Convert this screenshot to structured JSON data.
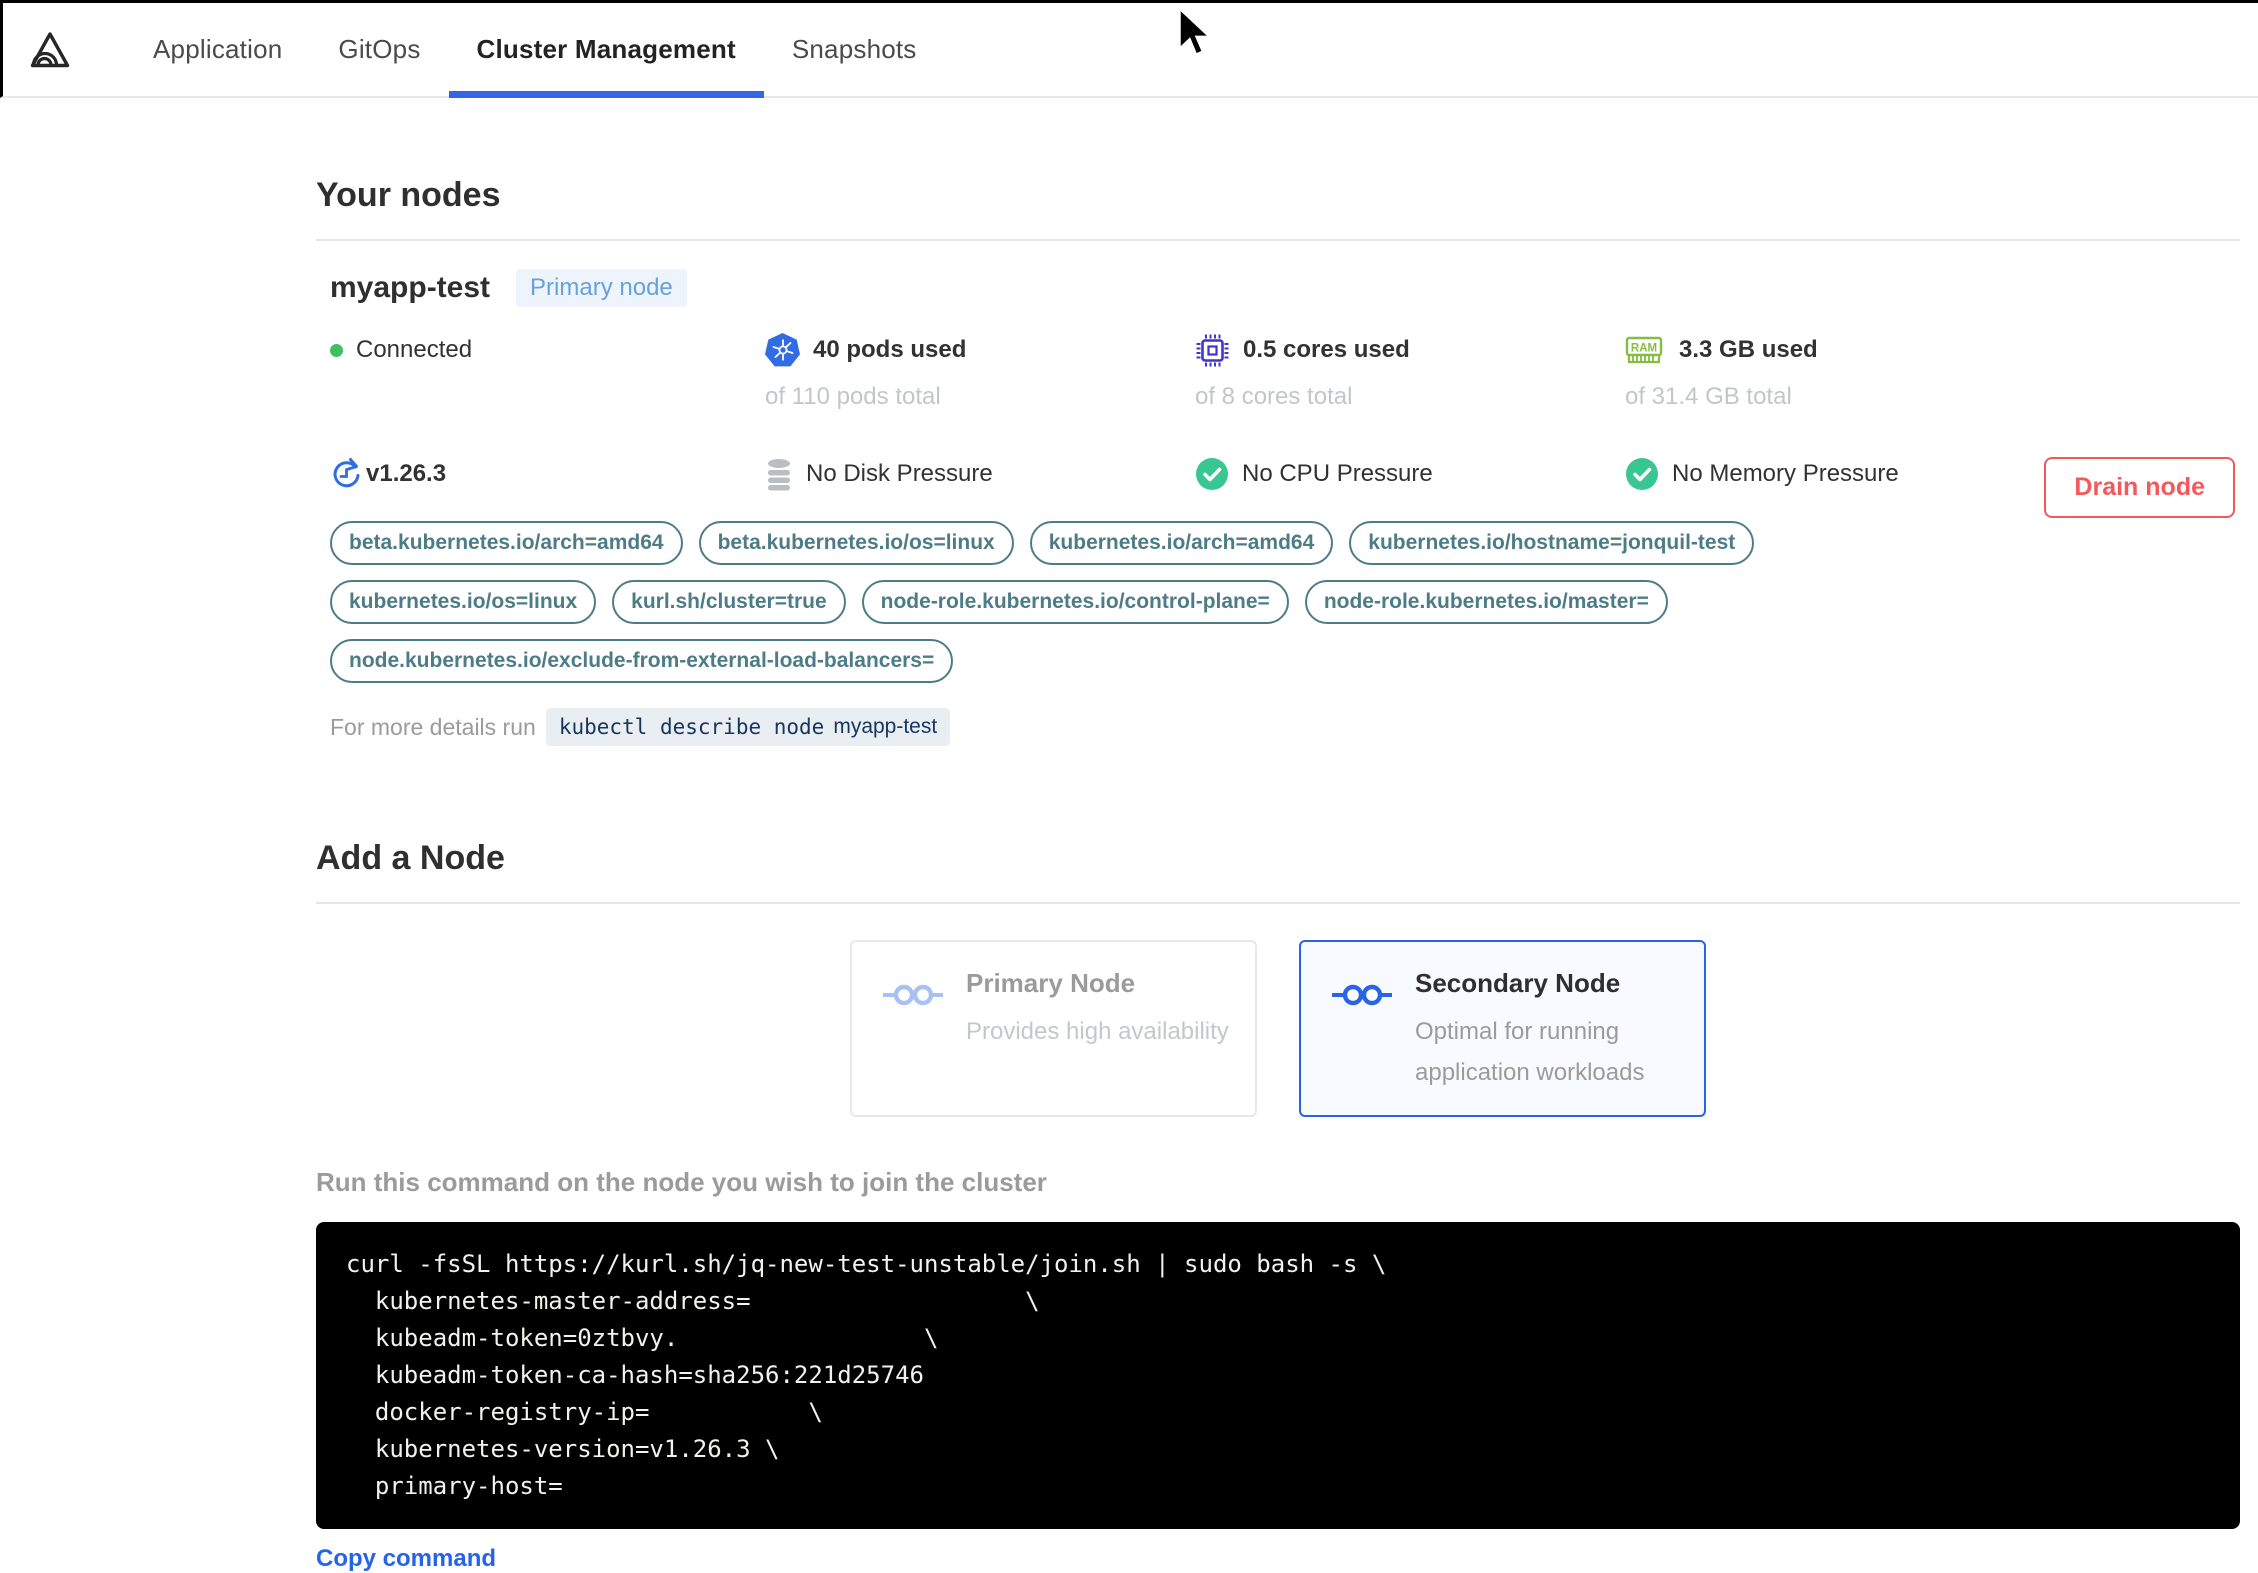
{
  "nav": {
    "logo": "app-logo-triangle-waves",
    "tabs": [
      {
        "label": "Application",
        "active": false
      },
      {
        "label": "GitOps",
        "active": false
      },
      {
        "label": "Cluster Management",
        "active": true
      },
      {
        "label": "Snapshots",
        "active": false
      }
    ]
  },
  "your_nodes": {
    "title": "Your nodes",
    "node": {
      "name": "myapp-test",
      "badge": "Primary node",
      "status": "Connected",
      "version": "v1.26.3",
      "stats": [
        {
          "icon": "kubernetes-icon",
          "used": "40 pods used",
          "total": "of 110 pods total"
        },
        {
          "icon": "cpu-icon",
          "used": "0.5 cores used",
          "total": "of 8 cores total"
        },
        {
          "icon": "ram-icon",
          "used": "3.3 GB used",
          "total": "of 31.4 GB total"
        }
      ],
      "conditions": [
        {
          "icon": "disk-icon",
          "label": "No Disk Pressure"
        },
        {
          "icon": "check-circle-icon",
          "label": "No CPU Pressure"
        },
        {
          "icon": "check-circle-icon",
          "label": "No Memory Pressure"
        }
      ],
      "labels": [
        "beta.kubernetes.io/arch=amd64",
        "beta.kubernetes.io/os=linux",
        "kubernetes.io/arch=amd64",
        "kubernetes.io/hostname=jonquil-test",
        "kubernetes.io/os=linux",
        "kurl.sh/cluster=true",
        "node-role.kubernetes.io/control-plane=",
        "node-role.kubernetes.io/master=",
        "node.kubernetes.io/exclude-from-external-load-balancers="
      ],
      "details": {
        "prefix": "For more details run",
        "command": "kubectl describe node",
        "node_name": "myapp-test"
      },
      "drain_button": "Drain node"
    }
  },
  "add_node": {
    "title": "Add a Node",
    "options": [
      {
        "title": "Primary Node",
        "description": "Provides high availability",
        "selected": false
      },
      {
        "title": "Secondary Node",
        "description": "Optimal for running application workloads",
        "selected": true
      }
    ],
    "instruction": "Run this command on the node you wish to join the cluster",
    "command_lines": [
      "curl -fsSL https://kurl.sh/jq-new-test-unstable/join.sh | sudo bash -s \\",
      "  kubernetes-master-address=                   \\",
      "  kubeadm-token=0ztbvy.                 \\",
      "  kubeadm-token-ca-hash=sha256:221d25746",
      "  docker-registry-ip=           \\",
      "  kubernetes-version=v1.26.3 \\",
      "  primary-host="
    ],
    "copy_label": "Copy command"
  },
  "colors": {
    "accent_blue": "#3666e8",
    "selected_card_blue": "#2b63e6",
    "drain_red": "#f2585c",
    "pill_teal": "#4d7c87",
    "kubernetes_blue": "#326ce5",
    "cpu_indigo": "#3f35cb",
    "ram_green": "#86bc40",
    "check_green": "#38c793",
    "connected_green": "#3fbe62",
    "badge_blue": "#68a1db",
    "link_blue": "#2563eb"
  }
}
